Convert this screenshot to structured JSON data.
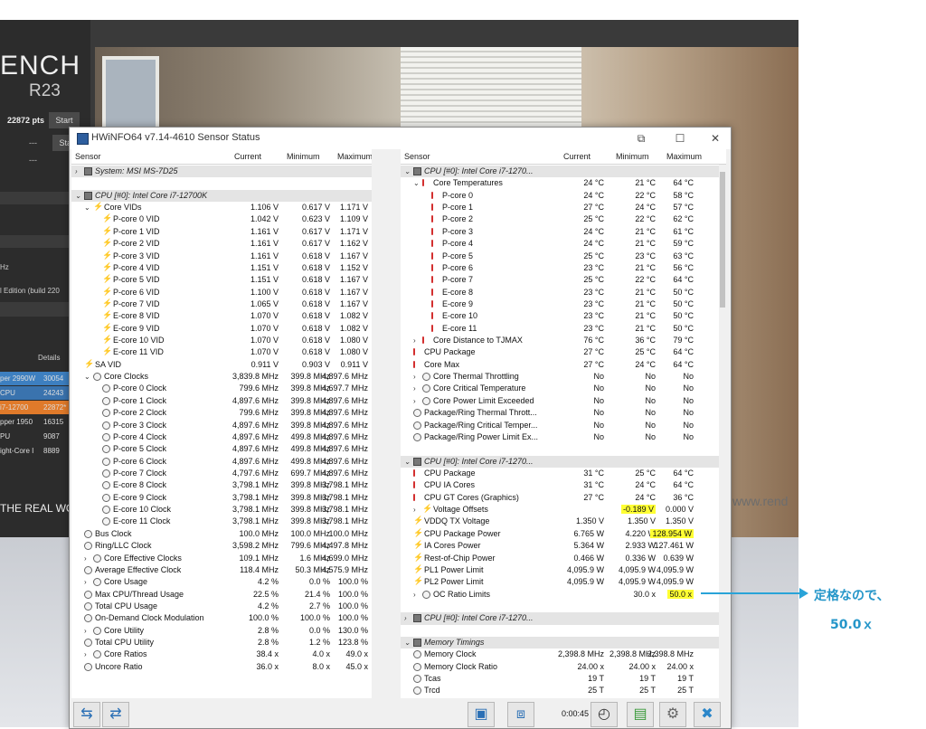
{
  "background": {
    "logo_line1": "ENCH",
    "logo_line2": "R23",
    "score": "22872 pts",
    "start_label": "Start",
    "dash1": "---",
    "dash2": "---",
    "build_text": "l Edition (build 220",
    "hz_text": "Hz",
    "details_label": "Details",
    "ranking": [
      {
        "name": "per 2990W",
        "value": "30054"
      },
      {
        "name": "CPU",
        "value": "24243"
      },
      {
        "name": "i7-12700",
        "value": "22872*"
      },
      {
        "name": "pper 1950",
        "value": "16315"
      },
      {
        "name": "PU",
        "value": "9087"
      },
      {
        "name": "ight-Core I",
        "value": "8889"
      }
    ],
    "tagline": "THE REAL WO",
    "watermark": "www.rend"
  },
  "window": {
    "title": "HWiNFO64 v7.14-4610 Sensor Status",
    "timer": "0:00:45"
  },
  "columns": {
    "sensor": "Sensor",
    "current": "Current",
    "minimum": "Minimum",
    "maximum": "Maximum"
  },
  "left_rows": [
    {
      "label": "System: MSI MS-7D25",
      "type": "hdr",
      "indent": 0,
      "icon": "chip",
      "exp": ">"
    },
    {
      "label": "",
      "type": "blank"
    },
    {
      "label": "CPU [#0]: Intel Core i7-12700K",
      "type": "hdr",
      "indent": 0,
      "icon": "chip",
      "exp": "v"
    },
    {
      "label": "Core VIDs",
      "indent": 1,
      "icon": "bolt",
      "exp": "v",
      "cur": "1.106 V",
      "min": "0.617 V",
      "max": "1.171 V"
    },
    {
      "label": "P-core 0 VID",
      "indent": 2,
      "icon": "bolt",
      "cur": "1.042 V",
      "min": "0.623 V",
      "max": "1.109 V"
    },
    {
      "label": "P-core 1 VID",
      "indent": 2,
      "icon": "bolt",
      "cur": "1.161 V",
      "min": "0.617 V",
      "max": "1.171 V"
    },
    {
      "label": "P-core 2 VID",
      "indent": 2,
      "icon": "bolt",
      "cur": "1.161 V",
      "min": "0.617 V",
      "max": "1.162 V"
    },
    {
      "label": "P-core 3 VID",
      "indent": 2,
      "icon": "bolt",
      "cur": "1.161 V",
      "min": "0.618 V",
      "max": "1.167 V"
    },
    {
      "label": "P-core 4 VID",
      "indent": 2,
      "icon": "bolt",
      "cur": "1.151 V",
      "min": "0.618 V",
      "max": "1.152 V"
    },
    {
      "label": "P-core 5 VID",
      "indent": 2,
      "icon": "bolt",
      "cur": "1.151 V",
      "min": "0.618 V",
      "max": "1.167 V"
    },
    {
      "label": "P-core 6 VID",
      "indent": 2,
      "icon": "bolt",
      "cur": "1.100 V",
      "min": "0.618 V",
      "max": "1.167 V"
    },
    {
      "label": "P-core 7 VID",
      "indent": 2,
      "icon": "bolt",
      "cur": "1.065 V",
      "min": "0.618 V",
      "max": "1.167 V"
    },
    {
      "label": "E-core 8 VID",
      "indent": 2,
      "icon": "bolt",
      "cur": "1.070 V",
      "min": "0.618 V",
      "max": "1.082 V"
    },
    {
      "label": "E-core 9 VID",
      "indent": 2,
      "icon": "bolt",
      "cur": "1.070 V",
      "min": "0.618 V",
      "max": "1.082 V"
    },
    {
      "label": "E-core 10 VID",
      "indent": 2,
      "icon": "bolt",
      "cur": "1.070 V",
      "min": "0.618 V",
      "max": "1.080 V"
    },
    {
      "label": "E-core 11 VID",
      "indent": 2,
      "icon": "bolt",
      "cur": "1.070 V",
      "min": "0.618 V",
      "max": "1.080 V"
    },
    {
      "label": "SA VID",
      "indent": 0,
      "icon": "bolt",
      "cur": "0.911 V",
      "min": "0.903 V",
      "max": "0.911 V"
    },
    {
      "label": "Core Clocks",
      "indent": 1,
      "icon": "clock",
      "exp": "v",
      "cur": "3,839.8 MHz",
      "min": "399.8 MHz",
      "max": "4,897.6 MHz"
    },
    {
      "label": "P-core 0 Clock",
      "indent": 2,
      "icon": "clock",
      "cur": "799.6 MHz",
      "min": "399.8 MHz",
      "max": "4,697.7 MHz"
    },
    {
      "label": "P-core 1 Clock",
      "indent": 2,
      "icon": "clock",
      "cur": "4,897.6 MHz",
      "min": "399.8 MHz",
      "max": "4,897.6 MHz"
    },
    {
      "label": "P-core 2 Clock",
      "indent": 2,
      "icon": "clock",
      "cur": "799.6 MHz",
      "min": "399.8 MHz",
      "max": "4,897.6 MHz"
    },
    {
      "label": "P-core 3 Clock",
      "indent": 2,
      "icon": "clock",
      "cur": "4,897.6 MHz",
      "min": "399.8 MHz",
      "max": "4,897.6 MHz"
    },
    {
      "label": "P-core 4 Clock",
      "indent": 2,
      "icon": "clock",
      "cur": "4,897.6 MHz",
      "min": "499.8 MHz",
      "max": "4,897.6 MHz"
    },
    {
      "label": "P-core 5 Clock",
      "indent": 2,
      "icon": "clock",
      "cur": "4,897.6 MHz",
      "min": "499.8 MHz",
      "max": "4,897.6 MHz"
    },
    {
      "label": "P-core 6 Clock",
      "indent": 2,
      "icon": "clock",
      "cur": "4,897.6 MHz",
      "min": "499.8 MHz",
      "max": "4,897.6 MHz"
    },
    {
      "label": "P-core 7 Clock",
      "indent": 2,
      "icon": "clock",
      "cur": "4,797.6 MHz",
      "min": "699.7 MHz",
      "max": "4,897.6 MHz"
    },
    {
      "label": "E-core 8 Clock",
      "indent": 2,
      "icon": "clock",
      "cur": "3,798.1 MHz",
      "min": "399.8 MHz",
      "max": "3,798.1 MHz"
    },
    {
      "label": "E-core 9 Clock",
      "indent": 2,
      "icon": "clock",
      "cur": "3,798.1 MHz",
      "min": "399.8 MHz",
      "max": "3,798.1 MHz"
    },
    {
      "label": "E-core 10 Clock",
      "indent": 2,
      "icon": "clock",
      "cur": "3,798.1 MHz",
      "min": "399.8 MHz",
      "max": "3,798.1 MHz"
    },
    {
      "label": "E-core 11 Clock",
      "indent": 2,
      "icon": "clock",
      "cur": "3,798.1 MHz",
      "min": "399.8 MHz",
      "max": "3,798.1 MHz"
    },
    {
      "label": "Bus Clock",
      "indent": 0,
      "icon": "clock",
      "cur": "100.0 MHz",
      "min": "100.0 MHz",
      "max": "100.0 MHz"
    },
    {
      "label": "Ring/LLC Clock",
      "indent": 0,
      "icon": "clock",
      "cur": "3,598.2 MHz",
      "min": "799.6 MHz",
      "max": "4,497.8 MHz"
    },
    {
      "label": "Core Effective Clocks",
      "indent": 1,
      "icon": "clock",
      "exp": ">",
      "cur": "109.1 MHz",
      "min": "1.6 MHz",
      "max": "4,699.0 MHz"
    },
    {
      "label": "Average Effective Clock",
      "indent": 0,
      "icon": "clock",
      "cur": "118.4 MHz",
      "min": "50.3 MHz",
      "max": "4,575.9 MHz"
    },
    {
      "label": "Core Usage",
      "indent": 1,
      "icon": "clock",
      "exp": ">",
      "cur": "4.2 %",
      "min": "0.0 %",
      "max": "100.0 %"
    },
    {
      "label": "Max CPU/Thread Usage",
      "indent": 0,
      "icon": "clock",
      "cur": "22.5 %",
      "min": "21.4 %",
      "max": "100.0 %"
    },
    {
      "label": "Total CPU Usage",
      "indent": 0,
      "icon": "clock",
      "cur": "4.2 %",
      "min": "2.7 %",
      "max": "100.0 %"
    },
    {
      "label": "On-Demand Clock Modulation",
      "indent": 0,
      "icon": "clock",
      "cur": "100.0 %",
      "min": "100.0 %",
      "max": "100.0 %"
    },
    {
      "label": "Core Utility",
      "indent": 1,
      "icon": "clock",
      "exp": ">",
      "cur": "2.8 %",
      "min": "0.0 %",
      "max": "130.0 %"
    },
    {
      "label": "Total CPU Utility",
      "indent": 0,
      "icon": "clock",
      "cur": "2.8 %",
      "min": "1.2 %",
      "max": "123.8 %"
    },
    {
      "label": "Core Ratios",
      "indent": 1,
      "icon": "clock",
      "exp": ">",
      "cur": "38.4 x",
      "min": "4.0 x",
      "max": "49.0 x"
    },
    {
      "label": "Uncore Ratio",
      "indent": 0,
      "icon": "clock",
      "cur": "36.0 x",
      "min": "8.0 x",
      "max": "45.0 x"
    }
  ],
  "right_rows": [
    {
      "label": "CPU [#0]: Intel Core i7-1270...",
      "type": "hdr",
      "indent": 0,
      "icon": "chip",
      "exp": "v"
    },
    {
      "label": "Core Temperatures",
      "indent": 1,
      "icon": "therm",
      "exp": "v",
      "cur": "24 °C",
      "min": "21 °C",
      "max": "64 °C"
    },
    {
      "label": "P-core 0",
      "indent": 2,
      "icon": "therm",
      "cur": "24 °C",
      "min": "22 °C",
      "max": "58 °C"
    },
    {
      "label": "P-core 1",
      "indent": 2,
      "icon": "therm",
      "cur": "27 °C",
      "min": "24 °C",
      "max": "57 °C"
    },
    {
      "label": "P-core 2",
      "indent": 2,
      "icon": "therm",
      "cur": "25 °C",
      "min": "22 °C",
      "max": "62 °C"
    },
    {
      "label": "P-core 3",
      "indent": 2,
      "icon": "therm",
      "cur": "24 °C",
      "min": "21 °C",
      "max": "61 °C"
    },
    {
      "label": "P-core 4",
      "indent": 2,
      "icon": "therm",
      "cur": "24 °C",
      "min": "21 °C",
      "max": "59 °C"
    },
    {
      "label": "P-core 5",
      "indent": 2,
      "icon": "therm",
      "cur": "25 °C",
      "min": "23 °C",
      "max": "63 °C"
    },
    {
      "label": "P-core 6",
      "indent": 2,
      "icon": "therm",
      "cur": "23 °C",
      "min": "21 °C",
      "max": "56 °C"
    },
    {
      "label": "P-core 7",
      "indent": 2,
      "icon": "therm",
      "cur": "25 °C",
      "min": "22 °C",
      "max": "64 °C"
    },
    {
      "label": "E-core 8",
      "indent": 2,
      "icon": "therm",
      "cur": "23 °C",
      "min": "21 °C",
      "max": "50 °C"
    },
    {
      "label": "E-core 9",
      "indent": 2,
      "icon": "therm",
      "cur": "23 °C",
      "min": "21 °C",
      "max": "50 °C"
    },
    {
      "label": "E-core 10",
      "indent": 2,
      "icon": "therm",
      "cur": "23 °C",
      "min": "21 °C",
      "max": "50 °C"
    },
    {
      "label": "E-core 11",
      "indent": 2,
      "icon": "therm",
      "cur": "23 °C",
      "min": "21 °C",
      "max": "50 °C"
    },
    {
      "label": "Core Distance to TJMAX",
      "indent": 1,
      "icon": "therm",
      "exp": ">",
      "cur": "76 °C",
      "min": "36 °C",
      "max": "79 °C"
    },
    {
      "label": "CPU Package",
      "indent": 0,
      "icon": "therm",
      "cur": "27 °C",
      "min": "25 °C",
      "max": "64 °C"
    },
    {
      "label": "Core Max",
      "indent": 0,
      "icon": "therm",
      "cur": "27 °C",
      "min": "24 °C",
      "max": "64 °C"
    },
    {
      "label": "Core Thermal Throttling",
      "indent": 1,
      "icon": "clock",
      "exp": ">",
      "cur": "No",
      "min": "No",
      "max": "No"
    },
    {
      "label": "Core Critical Temperature",
      "indent": 1,
      "icon": "clock",
      "exp": ">",
      "cur": "No",
      "min": "No",
      "max": "No"
    },
    {
      "label": "Core Power Limit Exceeded",
      "indent": 1,
      "icon": "clock",
      "exp": ">",
      "cur": "No",
      "min": "No",
      "max": "No"
    },
    {
      "label": "Package/Ring Thermal Thrott...",
      "indent": 0,
      "icon": "clock",
      "cur": "No",
      "min": "No",
      "max": "No"
    },
    {
      "label": "Package/Ring Critical Temper...",
      "indent": 0,
      "icon": "clock",
      "cur": "No",
      "min": "No",
      "max": "No"
    },
    {
      "label": "Package/Ring Power Limit Ex...",
      "indent": 0,
      "icon": "clock",
      "cur": "No",
      "min": "No",
      "max": "No"
    },
    {
      "label": "",
      "type": "blank"
    },
    {
      "label": "CPU [#0]: Intel Core i7-1270...",
      "type": "hdr",
      "indent": 0,
      "icon": "chip",
      "exp": "v"
    },
    {
      "label": "CPU Package",
      "indent": 0,
      "icon": "therm",
      "cur": "31 °C",
      "min": "25 °C",
      "max": "64 °C"
    },
    {
      "label": "CPU IA Cores",
      "indent": 0,
      "icon": "therm",
      "cur": "31 °C",
      "min": "24 °C",
      "max": "64 °C"
    },
    {
      "label": "CPU GT Cores (Graphics)",
      "indent": 0,
      "icon": "therm",
      "cur": "27 °C",
      "min": "24 °C",
      "max": "36 °C"
    },
    {
      "label": "Voltage Offsets",
      "indent": 1,
      "icon": "bolt",
      "exp": ">",
      "cur": "",
      "min": "-0.189 V",
      "max": "0.000 V",
      "hl": "min"
    },
    {
      "label": "VDDQ TX Voltage",
      "indent": 0,
      "icon": "bolt",
      "cur": "1.350 V",
      "min": "1.350 V",
      "max": "1.350 V"
    },
    {
      "label": "CPU Package Power",
      "indent": 0,
      "icon": "bolt",
      "cur": "6.765 W",
      "min": "4.220 W",
      "max": "128.954 W",
      "hl": "max"
    },
    {
      "label": "IA Cores Power",
      "indent": 0,
      "icon": "bolt",
      "cur": "5.364 W",
      "min": "2.933 W",
      "max": "127.461 W"
    },
    {
      "label": "Rest-of-Chip Power",
      "indent": 0,
      "icon": "bolt",
      "cur": "0.466 W",
      "min": "0.336 W",
      "max": "0.639 W"
    },
    {
      "label": "PL1 Power Limit",
      "indent": 0,
      "icon": "bolt",
      "cur": "4,095.9 W",
      "min": "4,095.9 W",
      "max": "4,095.9 W"
    },
    {
      "label": "PL2 Power Limit",
      "indent": 0,
      "icon": "bolt",
      "cur": "4,095.9 W",
      "min": "4,095.9 W",
      "max": "4,095.9 W"
    },
    {
      "label": "OC Ratio Limits",
      "indent": 1,
      "icon": "clock",
      "exp": ">",
      "cur": "",
      "min": "30.0 x",
      "max": "50.0 x",
      "hl": "max"
    },
    {
      "label": "",
      "type": "blank"
    },
    {
      "label": "CPU [#0]: Intel Core i7-1270...",
      "type": "hdr",
      "indent": 0,
      "icon": "chip",
      "exp": ">"
    },
    {
      "label": "",
      "type": "blank"
    },
    {
      "label": "Memory Timings",
      "type": "hdr",
      "indent": 0,
      "icon": "chip",
      "exp": "v"
    },
    {
      "label": "Memory Clock",
      "indent": 0,
      "icon": "clock",
      "cur": "2,398.8 MHz",
      "min": "2,398.8 MHz",
      "max": "2,398.8 MHz"
    },
    {
      "label": "Memory Clock Ratio",
      "indent": 0,
      "icon": "clock",
      "cur": "24.00 x",
      "min": "24.00 x",
      "max": "24.00 x"
    },
    {
      "label": "Tcas",
      "indent": 0,
      "icon": "clock",
      "cur": "19 T",
      "min": "19 T",
      "max": "19 T"
    },
    {
      "label": "Trcd",
      "indent": 0,
      "icon": "clock",
      "cur": "25 T",
      "min": "25 T",
      "max": "25 T"
    }
  ],
  "annotation": {
    "line1": "定格なので、",
    "line2": "50.0ｘ",
    "color": "#29a3d8"
  },
  "colors": {
    "highlight": "#ffff33",
    "header_row": "#e4e4e4"
  }
}
